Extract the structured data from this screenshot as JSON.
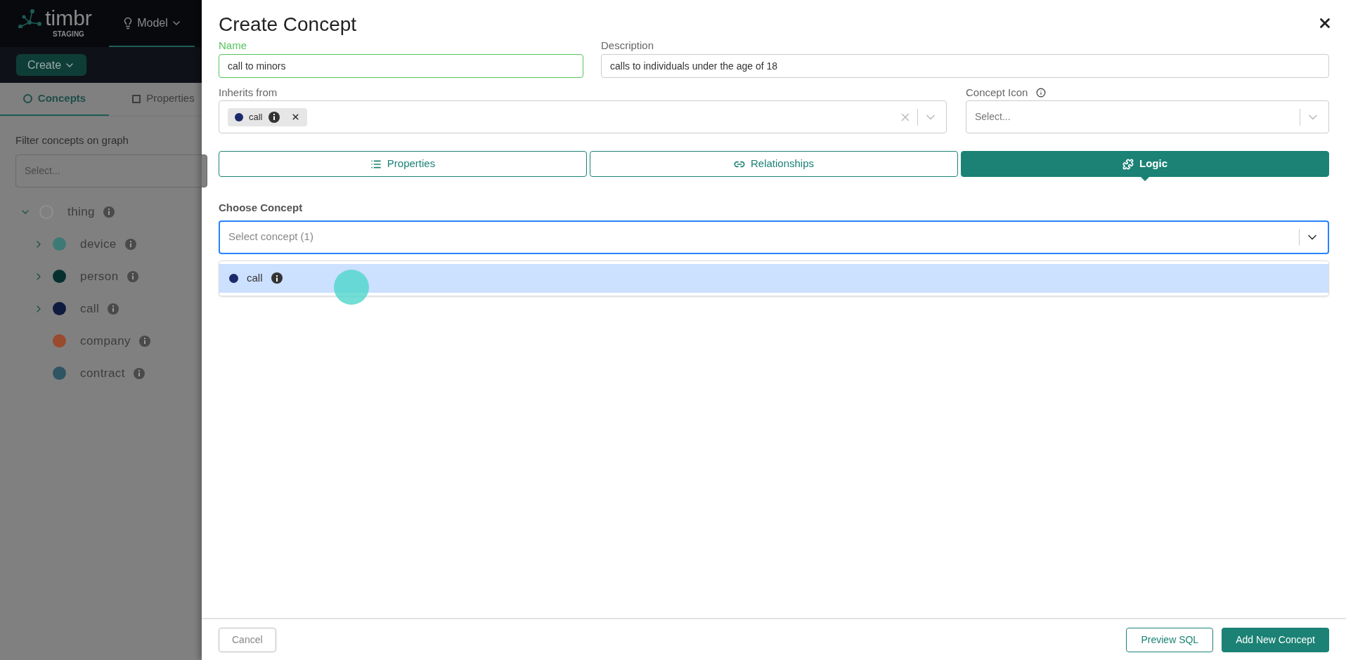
{
  "app": {
    "logo_text": "timbr",
    "environment": "STAGING",
    "nav": [
      {
        "label": "Model",
        "selected": true
      }
    ],
    "create_button": "Create"
  },
  "sidebar": {
    "tabs": [
      {
        "label": "Concepts",
        "selected": true
      },
      {
        "label": "Properties",
        "selected": false
      }
    ],
    "filter_label": "Filter concepts on graph",
    "filter_placeholder": "Select...",
    "tree": [
      {
        "label": "thing",
        "kind": "hollow",
        "color": "#8f8f8f",
        "expanded": true,
        "children": [
          {
            "label": "device",
            "kind": "dot",
            "color": "#3d7a76",
            "expanded": false
          },
          {
            "label": "person",
            "kind": "dot",
            "color": "#06302f",
            "expanded": false
          },
          {
            "label": "call",
            "kind": "dot",
            "color": "#0f1a40",
            "expanded": false
          },
          {
            "label": "company",
            "kind": "dot",
            "color": "#9a4a2e"
          },
          {
            "label": "contract",
            "kind": "dot",
            "color": "#2f5563"
          }
        ]
      }
    ]
  },
  "dialog": {
    "title": "Create Concept",
    "name": {
      "label": "Name",
      "value": "call to minors"
    },
    "description": {
      "label": "Description",
      "value": "calls to individuals under the age of 18"
    },
    "inherits_from": {
      "label": "Inherits from",
      "tags": [
        {
          "label": "call",
          "color": "#1c2a6b"
        }
      ]
    },
    "concept_icon": {
      "label": "Concept Icon",
      "placeholder": "Select..."
    },
    "tabs": [
      {
        "label": "Properties",
        "kind": "list",
        "selected": false
      },
      {
        "label": "Relationships",
        "kind": "link",
        "selected": false
      },
      {
        "label": "Logic",
        "kind": "puzzle",
        "selected": true
      }
    ],
    "choose_concept": {
      "label": "Choose Concept",
      "placeholder": "Select concept (1)",
      "options": [
        {
          "label": "call",
          "color": "#1c2a6b",
          "selected": true
        }
      ]
    },
    "footer": {
      "cancel": "Cancel",
      "preview": "Preview SQL",
      "submit": "Add New Concept"
    }
  }
}
